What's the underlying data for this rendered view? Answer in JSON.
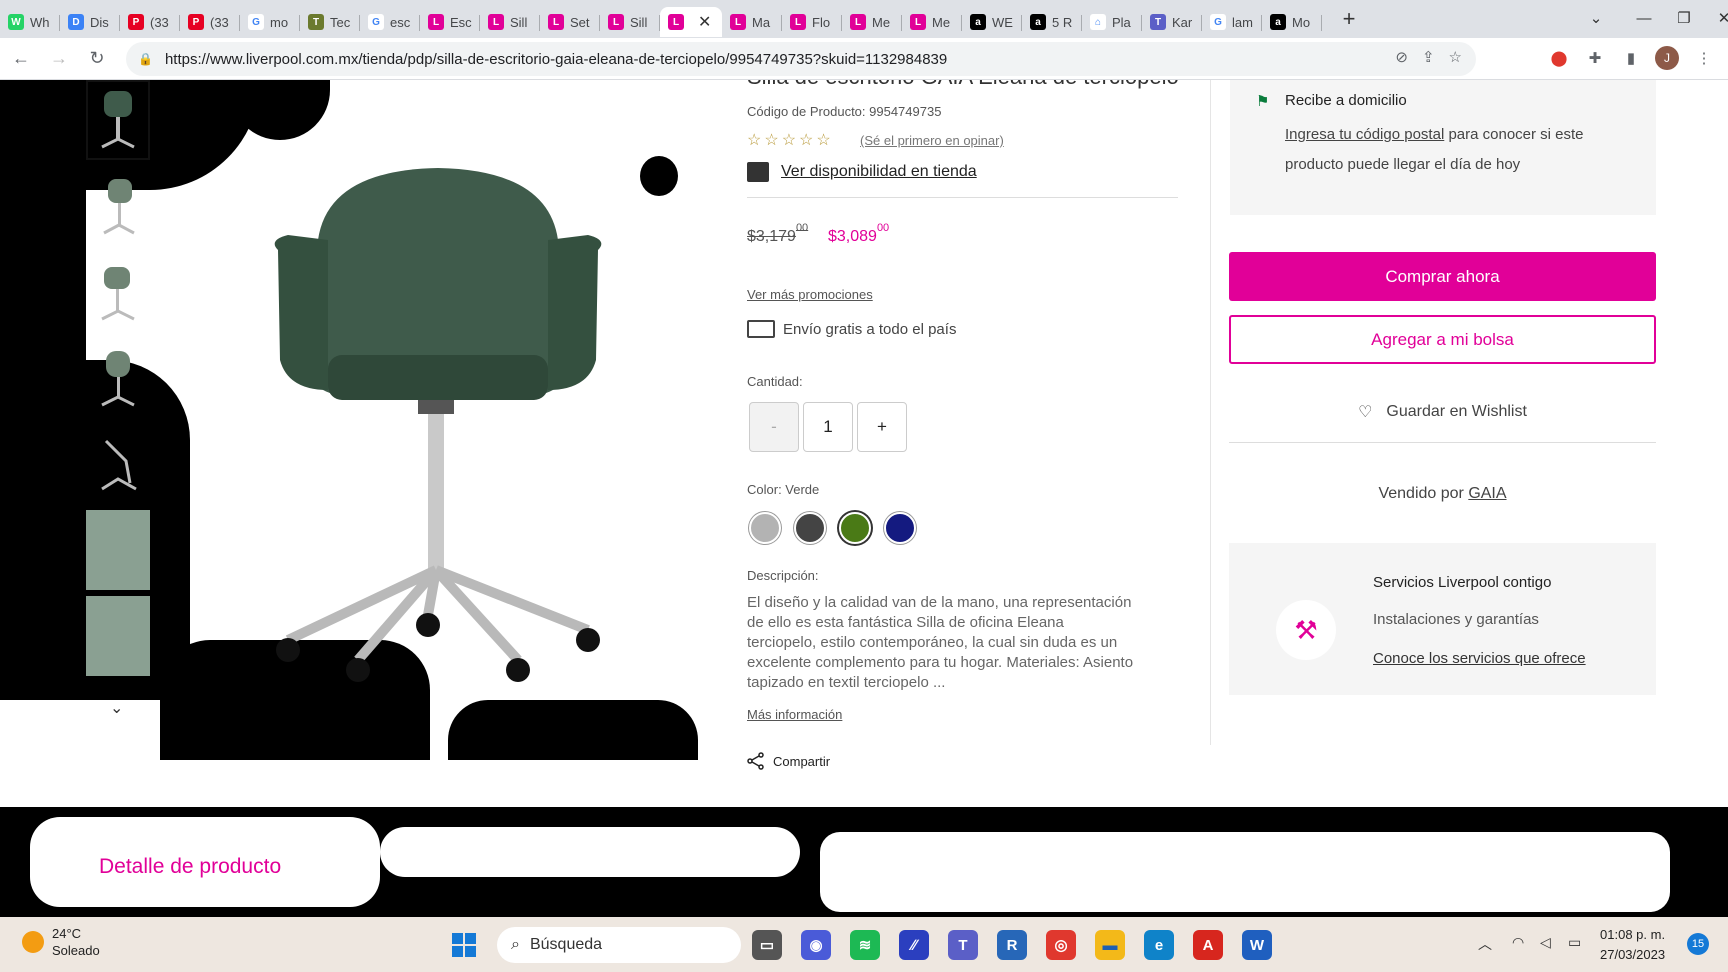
{
  "browser": {
    "tabs": [
      {
        "label": "Wh",
        "color": "#25d366",
        "glyph": "W"
      },
      {
        "label": "Dis",
        "color": "#3b82f6",
        "glyph": "D"
      },
      {
        "label": "(33",
        "color": "#e60023",
        "glyph": "P"
      },
      {
        "label": "(33",
        "color": "#e60023",
        "glyph": "P"
      },
      {
        "label": "mo",
        "color": "#ffffff",
        "glyph": "G"
      },
      {
        "label": "Tec",
        "color": "#6b7a2e",
        "glyph": "T"
      },
      {
        "label": "esc",
        "color": "#ffffff",
        "glyph": "G"
      },
      {
        "label": "Esc",
        "color": "#e10098",
        "glyph": "L"
      },
      {
        "label": "Sill",
        "color": "#e10098",
        "glyph": "L"
      },
      {
        "label": "Set",
        "color": "#e10098",
        "glyph": "L"
      },
      {
        "label": "Sill",
        "color": "#e10098",
        "glyph": "L"
      },
      {
        "label": "",
        "color": "#e10098",
        "glyph": "L",
        "active": true
      },
      {
        "label": "Ma",
        "color": "#e10098",
        "glyph": "L"
      },
      {
        "label": "Flo",
        "color": "#e10098",
        "glyph": "L"
      },
      {
        "label": "Me",
        "color": "#e10098",
        "glyph": "L"
      },
      {
        "label": "Me",
        "color": "#e10098",
        "glyph": "L"
      },
      {
        "label": "WE",
        "color": "#000000",
        "glyph": "a"
      },
      {
        "label": "5 R",
        "color": "#000000",
        "glyph": "a"
      },
      {
        "label": "Pla",
        "color": "#ffffff",
        "glyph": "⌂"
      },
      {
        "label": "Kar",
        "color": "#5b5fc7",
        "glyph": "T"
      },
      {
        "label": "lam",
        "color": "#ffffff",
        "glyph": "G"
      },
      {
        "label": "Mo",
        "color": "#000000",
        "glyph": "a"
      }
    ],
    "url": "https://www.liverpool.com.mx/tienda/pdp/silla-de-escritorio-gaia-eleana-de-terciopelo/9954749735?skuid=1132984839",
    "profile_initial": "J"
  },
  "product": {
    "title": "Silla de escritorio GAIA Eleana de terciopelo",
    "code": "Código de Producto: 9954749735",
    "rating_stars": 5,
    "review_link": "(Sé el primero en opinar)",
    "store_availability": "Ver disponibilidad en tienda",
    "price_old": "$3,179",
    "price_old_cents": "00",
    "price_new": "$3,089",
    "price_new_cents": "00",
    "promotions": "Ver más promociones",
    "shipping": "Envío gratis a todo el país",
    "quantity_label": "Cantidad:",
    "quantity": "1",
    "minus": "-",
    "plus": "+",
    "color_label": "Color: Verde",
    "colors": [
      "#b3b3b3",
      "#444444",
      "#4a7a16",
      "#141a80"
    ],
    "selected_color": 2,
    "description_label": "Descripción:",
    "description": "El diseño y la calidad van de la mano, una representación de ello es esta fantástica Silla de oficina Eleana terciopelo, estilo contemporáneo, la cual sin duda es un excelente complemento para tu hogar. Materiales: Asiento tapizado en textil terciopelo ...",
    "more_info": "Más información",
    "share": "Compartir",
    "chair_color": "#3f5b4b"
  },
  "sidebar": {
    "delivery_title": "Recibe a domicilio",
    "postal_link": "Ingresa tu código postal",
    "postal_text": " para conocer si este producto puede llegar el día de hoy",
    "buy_now": "Comprar ahora",
    "add_to_bag": "Agregar a mi bolsa",
    "wishlist": "Guardar en Wishlist",
    "sold_by_prefix": "Vendido por ",
    "seller": "GAIA",
    "services_title": "Servicios Liverpool contigo",
    "services_sub": "Instalaciones y garantías",
    "services_link": "Conoce los servicios que ofrece"
  },
  "section": {
    "detail_title": "Detalle de producto"
  },
  "taskbar": {
    "temp": "24°C",
    "weather": "Soleado",
    "search_placeholder": "Búsqueda",
    "time": "01:08 p. m.",
    "date": "27/03/2023",
    "notifications": "15",
    "apps": [
      {
        "name": "files-icon",
        "color": "#555555",
        "glyph": "▭"
      },
      {
        "name": "zoom-icon",
        "color": "#4a5bd8",
        "glyph": "◉"
      },
      {
        "name": "spotify-icon",
        "color": "#1db954",
        "glyph": "≋"
      },
      {
        "name": "app-icon",
        "color": "#2b3fbf",
        "glyph": "∕∕"
      },
      {
        "name": "teams-icon",
        "color": "#5b5fc7",
        "glyph": "T"
      },
      {
        "name": "r-icon",
        "color": "#2767b8",
        "glyph": "R"
      },
      {
        "name": "chrome-icon",
        "color": "#e0382e",
        "glyph": "◎"
      },
      {
        "name": "folder-icon",
        "color": "#f3b919",
        "glyph": "▬"
      },
      {
        "name": "edge-icon",
        "color": "#0f83c9",
        "glyph": "e"
      },
      {
        "name": "acrobat-icon",
        "color": "#d7261e",
        "glyph": "A"
      },
      {
        "name": "word-icon",
        "color": "#1f5fbf",
        "glyph": "W"
      }
    ]
  }
}
